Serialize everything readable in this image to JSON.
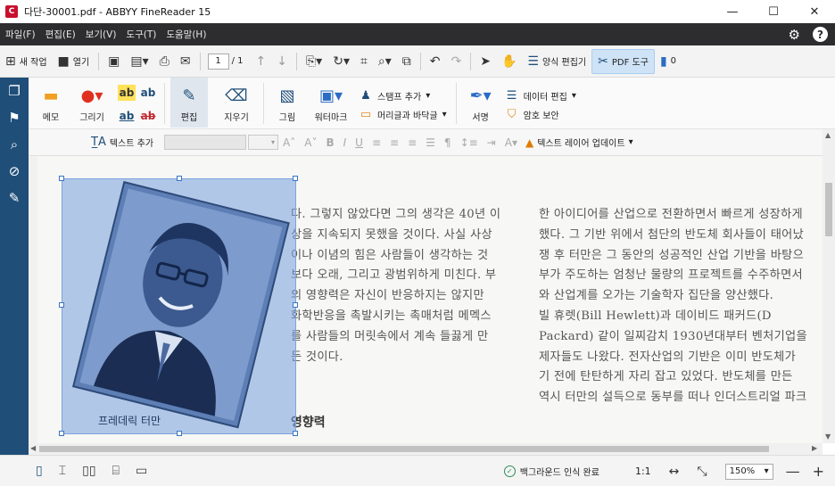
{
  "window": {
    "title": "다단-30001.pdf - ABBYY FineReader 15",
    "minimize": "—",
    "maximize": "☐",
    "close": "✕"
  },
  "menu": [
    "파일(F)",
    "편집(E)",
    "보기(V)",
    "도구(T)",
    "도움말(H)"
  ],
  "toolbar": {
    "new_task": "새 작업",
    "open": "열기",
    "page_current": "1",
    "page_total": "/ 1",
    "form_editor": "양식 편집기",
    "pdf_tools": "PDF 도구",
    "comments_count": "0"
  },
  "ribbon": {
    "memo": "메모",
    "draw": "그리기",
    "ab": "ab",
    "edit": "편집",
    "erase": "지우기",
    "picture": "그림",
    "watermark": "워터마크",
    "add_stamp": "스탬프 추가",
    "header_footer": "머리글과 바닥글",
    "signature": "서명",
    "edit_data": "데이터 편집",
    "encrypt": "암호 보안"
  },
  "format_bar": {
    "add_text": "텍스트 추가",
    "update_text_layer": "텍스트 레이어 업데이트"
  },
  "document": {
    "col1_lines": [
      "다. 그렇지 않았다면 그의 생각은 40년 이",
      "상을 지속되지 못했을 것이다. 사실 사상",
      "이나 이념의 힘은 사람들이 생각하는 것",
      "보다 오래, 그리고 광범위하게 미친다. 부",
      "의 영향력은 자신이 반응하지는 않지만",
      "화학반응을 촉발시키는 촉매처럼 메멕스",
      "를 사람들의 머릿속에서 계속 들끓게 만",
      "든 것이다."
    ],
    "heading": "영향력",
    "col2_lines": [
      "한 아이디어를 산업으로 전환하면서 빠르게 성장하게",
      "했다. 그 기반 위에서 첨단의 반도체 회사들이 태어났",
      "쟁 후 터만은 그 동안의 성공적인 산업 기반을 바탕으",
      "부가 주도하는 엄청난 물량의 프로젝트를 수주하면서",
      "와 산업계를 오가는 기술학자 집단을 양산했다.",
      "  빌 휴렛(Bill Hewlett)과 데이비드 패커드(D",
      "Packard) 같이 일찌감치 1930년대부터 벤처기업을",
      "제자들도 나왔다. 전자산업의 기반은 이미 반도체가",
      "기 전에 탄탄하게 자리 잡고 있었다. 반도체를 만든",
      "역시 터만의 설득으로 동부를 떠나 인더스트리얼 파크"
    ],
    "image_caption": "프레데릭 터만"
  },
  "status": {
    "background_ocr": "백그라운드 인식 완료",
    "zoom_1to1": "1:1",
    "zoom_value": "150%"
  },
  "colors": {
    "menubar": "#2d2d30",
    "leftnav": "#1f4e79",
    "selection": "#78a0dc",
    "accent": "#3a74c4"
  }
}
